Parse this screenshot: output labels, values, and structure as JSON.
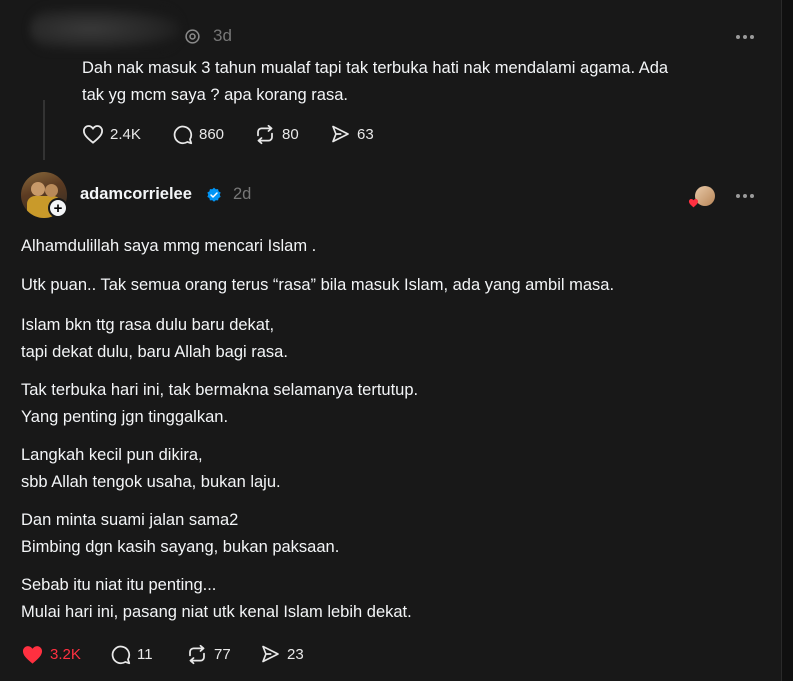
{
  "top_post": {
    "time": "3d",
    "text_line1": "Dah nak masuk 3 tahun mualaf tapi tak terbuka hati nak mendalami agama. Ada",
    "text_line2": "tak yg mcm saya ? apa korang rasa.",
    "likes": "2.4K",
    "replies": "860",
    "reposts": "80",
    "shares": "63"
  },
  "reply_post": {
    "username": "adamcorrielee",
    "time": "2d",
    "paragraphs": [
      "Alhamdulillah saya mmg mencari Islam .",
      "Utk puan.. Tak semua orang terus “rasa” bila masuk Islam, ada yang ambil masa.",
      "Islam bkn ttg rasa dulu baru dekat,",
      "tapi dekat dulu, baru Allah bagi rasa.",
      "Tak terbuka hari ini, tak bermakna selamanya tertutup.",
      "Yang penting jgn tinggalkan.",
      "Langkah kecil pun dikira,",
      "sbb Allah tengok usaha, bukan laju.",
      "Dan minta suami jalan sama2",
      "Bimbing dgn kasih sayang, bukan paksaan.",
      "Sebab itu niat itu penting...",
      "Mulai hari ini, pasang niat utk kenal Islam lebih dekat."
    ],
    "likes": "3.2K",
    "replies": "11",
    "reposts": "77",
    "shares": "23"
  },
  "icons": {
    "like": "heart-icon",
    "liked": "heart-filled-icon",
    "reply": "speech-bubble-icon",
    "repost": "repost-icon",
    "share": "send-icon",
    "more": "more-horizontal-icon",
    "verified": "verified-badge-icon",
    "follow": "plus-icon",
    "threads": "threads-logo-icon"
  },
  "colors": {
    "background": "#181818",
    "text": "#f3f5f7",
    "muted": "#777777",
    "liked": "#ff3040",
    "verified": "#0095f6"
  }
}
